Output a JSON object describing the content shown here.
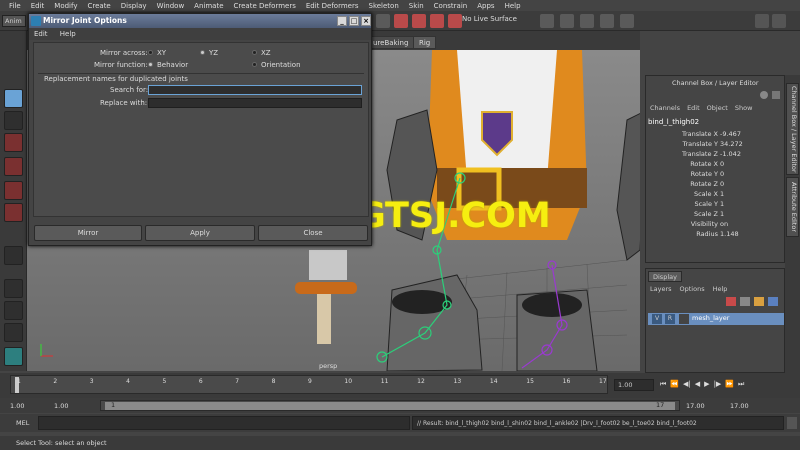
{
  "menubar": {
    "items": [
      "File",
      "Edit",
      "Modify",
      "Create",
      "Display",
      "Window",
      "Animate",
      "Create Deformers",
      "Edit Deformers",
      "Skeleton",
      "Skin",
      "Constrain",
      "Apps",
      "Help"
    ]
  },
  "statusline": {
    "mode": "Anim",
    "live_surface": "No Live Surface"
  },
  "shelf": {
    "tabs": [
      "ureBaking",
      "Rig"
    ]
  },
  "dialog": {
    "title": "Mirror Joint Options",
    "menu": [
      "Edit",
      "Help"
    ],
    "mirror_across_label": "Mirror across:",
    "mirror_across_options": [
      "XY",
      "YZ",
      "XZ"
    ],
    "mirror_across_selected": "YZ",
    "mirror_function_label": "Mirror function:",
    "mirror_function_options": [
      "Behavior",
      "Orientation"
    ],
    "mirror_function_selected": "Behavior",
    "replacement_header": "Replacement names for duplicated joints",
    "search_for_label": "Search for:",
    "search_for_value": "",
    "replace_with_label": "Replace with:",
    "replace_with_value": "",
    "buttons": [
      "Mirror",
      "Apply",
      "Close"
    ]
  },
  "viewport": {
    "camera": "persp"
  },
  "watermark": "WWW.CGTSJ.COM",
  "channel_box": {
    "title": "Channel Box / Layer Editor",
    "menu": [
      "Channels",
      "Edit",
      "Object",
      "Show"
    ],
    "object_name": "bind_l_thigh02",
    "channels": [
      {
        "name": "Translate X",
        "value": "-9.467"
      },
      {
        "name": "Translate Y",
        "value": "34.272"
      },
      {
        "name": "Translate Z",
        "value": "-1.042"
      },
      {
        "name": "Rotate X",
        "value": "0"
      },
      {
        "name": "Rotate Y",
        "value": "0"
      },
      {
        "name": "Rotate Z",
        "value": "0"
      },
      {
        "name": "Scale X",
        "value": "1"
      },
      {
        "name": "Scale Y",
        "value": "1"
      },
      {
        "name": "Scale Z",
        "value": "1"
      },
      {
        "name": "Visibility",
        "value": "on"
      },
      {
        "name": "Radius",
        "value": "1.148"
      }
    ],
    "side_tabs": [
      "Channel Box / Layer Editor",
      "Attribute Editor"
    ]
  },
  "layer_editor": {
    "tab": "Display",
    "menu": [
      "Layers",
      "Options",
      "Help"
    ],
    "layer": {
      "v": "V",
      "r": "R",
      "name": "mesh_layer"
    }
  },
  "timeline": {
    "ticks": [
      "1",
      "2",
      "3",
      "4",
      "5",
      "6",
      "7",
      "8",
      "9",
      "10",
      "11",
      "12",
      "13",
      "14",
      "15",
      "16",
      "17"
    ],
    "current_frame": "1.00",
    "range_start": "1.00",
    "range_start_inner": "1.00",
    "range_slider_start": "1",
    "range_slider_end": "17",
    "range_end_inner": "17.00",
    "range_end": "17.00"
  },
  "command_line": {
    "label": "MEL",
    "result": "// Result: bind_l_thigh02 bind_l_shin02 bind_l_ankle02 |Drv_l_foot02 be_l_toe02 bind_l_foot02"
  },
  "help_line": {
    "text": "Select Tool: select an object"
  },
  "colors": {
    "accent": "#6aa3d6",
    "watermark": "#f6ee10",
    "title_bar": "#4d5b75"
  }
}
